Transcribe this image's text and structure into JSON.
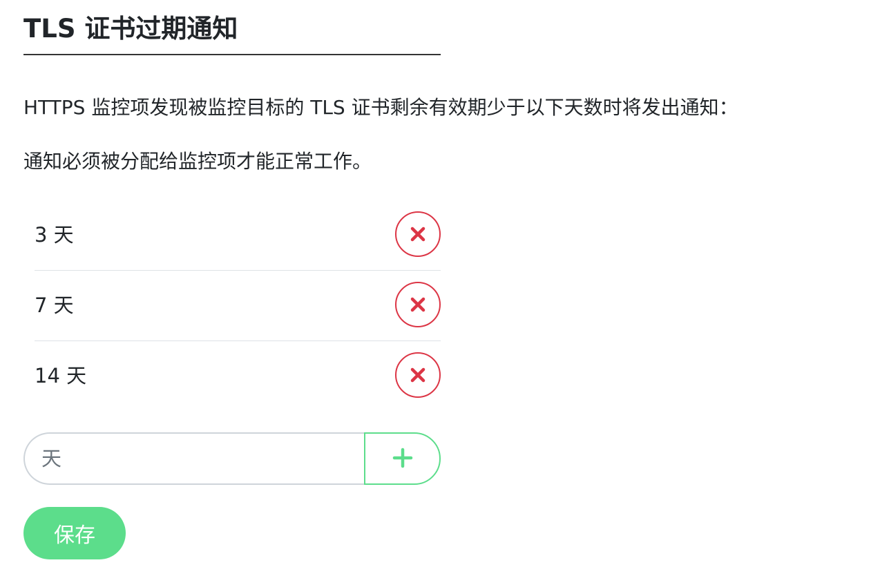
{
  "header": {
    "title": "TLS 证书过期通知"
  },
  "description": {
    "line1": "HTTPS 监控项发现被监控目标的 TLS 证书剩余有效期少于以下天数时将发出通知：",
    "line2": "通知必须被分配给监控项才能正常工作。"
  },
  "days_list": [
    {
      "label": "3 天",
      "remove_icon": "close-icon"
    },
    {
      "label": "7 天",
      "remove_icon": "close-icon"
    },
    {
      "label": "14 天",
      "remove_icon": "close-icon"
    }
  ],
  "add_form": {
    "input_value": "",
    "input_placeholder": "天",
    "add_icon": "plus-icon"
  },
  "actions": {
    "save_label": "保存"
  },
  "colors": {
    "danger": "#dc3545",
    "primary": "#5cdd8b",
    "text": "#212529",
    "placeholder": "#6c757d"
  }
}
